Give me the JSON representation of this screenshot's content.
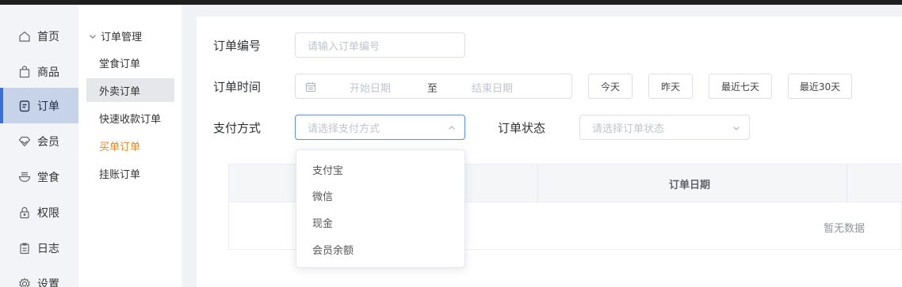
{
  "sidebar": {
    "items": [
      {
        "label": "首页",
        "icon": "home-icon"
      },
      {
        "label": "商品",
        "icon": "bag-icon"
      },
      {
        "label": "订单",
        "icon": "order-icon",
        "active": true
      },
      {
        "label": "会员",
        "icon": "diamond-icon"
      },
      {
        "label": "堂食",
        "icon": "bowl-icon"
      },
      {
        "label": "权限",
        "icon": "lock-icon"
      },
      {
        "label": "日志",
        "icon": "clipboard-icon"
      },
      {
        "label": "设置",
        "icon": "gear-icon"
      }
    ],
    "accent_color": "#3a6fd8"
  },
  "subnav": {
    "group_label": "订单管理",
    "items": [
      {
        "label": "堂食订单"
      },
      {
        "label": "外卖订单",
        "active": true
      },
      {
        "label": "快速收款订单"
      },
      {
        "label": "买单订单",
        "highlight_color": "#e6862b"
      },
      {
        "label": "挂账订单"
      }
    ]
  },
  "filters": {
    "order_no_label": "订单编号",
    "order_no_placeholder": "请输入订单编号",
    "order_time_label": "订单时间",
    "start_date_placeholder": "开始日期",
    "range_separator": "至",
    "end_date_placeholder": "结束日期",
    "quick_buttons": [
      "今天",
      "昨天",
      "最近七天",
      "最近30天"
    ],
    "payment_label": "支付方式",
    "payment_placeholder": "请选择支付方式",
    "status_label": "订单状态",
    "status_placeholder": "请选择订单状态"
  },
  "payment_dropdown": {
    "open": true,
    "options": [
      "支付宝",
      "微信",
      "现金",
      "会员余额"
    ]
  },
  "table": {
    "columns": [
      "订单日期"
    ],
    "empty_text": "暂无数据"
  }
}
